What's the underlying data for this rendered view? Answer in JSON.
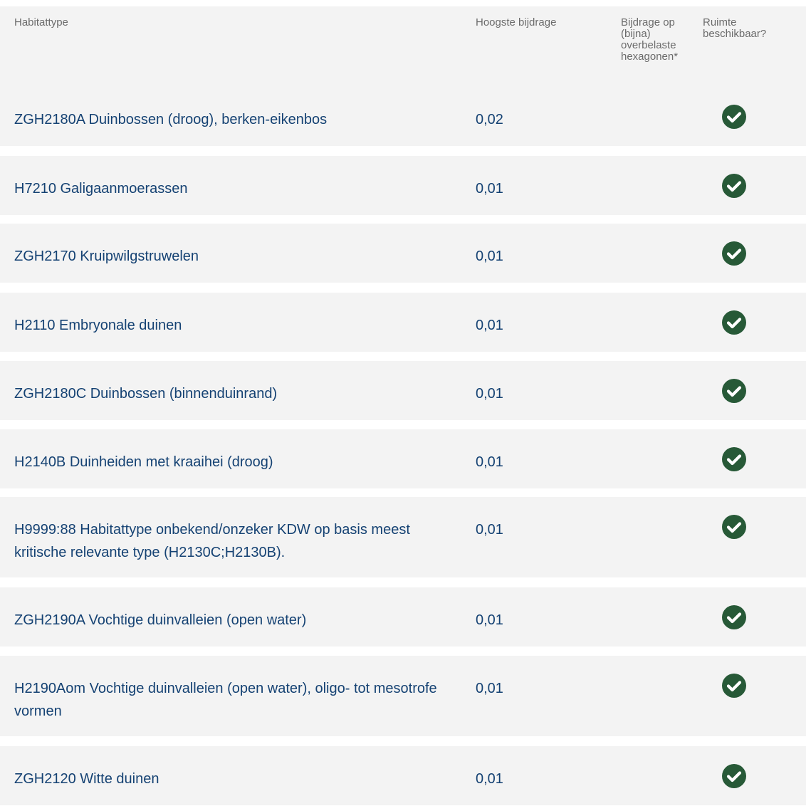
{
  "headers": {
    "name": "Habitattype",
    "max": "Hoogste bijdrage",
    "over_line1": "Bijdrage op",
    "over_line2": "(bijna)",
    "over_line3": "overbelaste",
    "over_line4": "hexagonen*",
    "space_line1": "Ruimte",
    "space_line2": "beschikbaar?"
  },
  "colors": {
    "header_bg": "#f3f3f3",
    "row_bg": "#f3f3f3",
    "text_blue": "#154273",
    "header_text": "#6b6b6b",
    "check_green": "#275937"
  },
  "rows": [
    {
      "name": "ZGH2180A Duinbossen (droog), berken-eikenbos",
      "max": "0,02",
      "space_icon": "check-circle-icon"
    },
    {
      "name": "H7210 Galigaanmoerassen",
      "max": "0,01",
      "space_icon": "check-circle-icon"
    },
    {
      "name": "ZGH2170 Kruipwilgstruwelen",
      "max": "0,01",
      "space_icon": "check-circle-icon"
    },
    {
      "name": "H2110 Embryonale duinen",
      "max": "0,01",
      "space_icon": "check-circle-icon"
    },
    {
      "name": "ZGH2180C Duinbossen (binnenduinrand)",
      "max": "0,01",
      "space_icon": "check-circle-icon"
    },
    {
      "name": "H2140B Duinheiden met kraaihei (droog)",
      "max": "0,01",
      "space_icon": "check-circle-icon"
    },
    {
      "name": "H9999:88 Habitattype onbekend/onzeker KDW op basis meest kritische relevante type (H2130C;H2130B).",
      "max": "0,01",
      "space_icon": "check-circle-icon"
    },
    {
      "name": "ZGH2190A Vochtige duinvalleien (open water)",
      "max": "0,01",
      "space_icon": "check-circle-icon"
    },
    {
      "name": "H2190Aom Vochtige duinvalleien (open water), oligo- tot mesotrofe vormen",
      "max": "0,01",
      "space_icon": "check-circle-icon"
    },
    {
      "name": "ZGH2120 Witte duinen",
      "max": "0,01",
      "space_icon": "check-circle-icon"
    }
  ]
}
